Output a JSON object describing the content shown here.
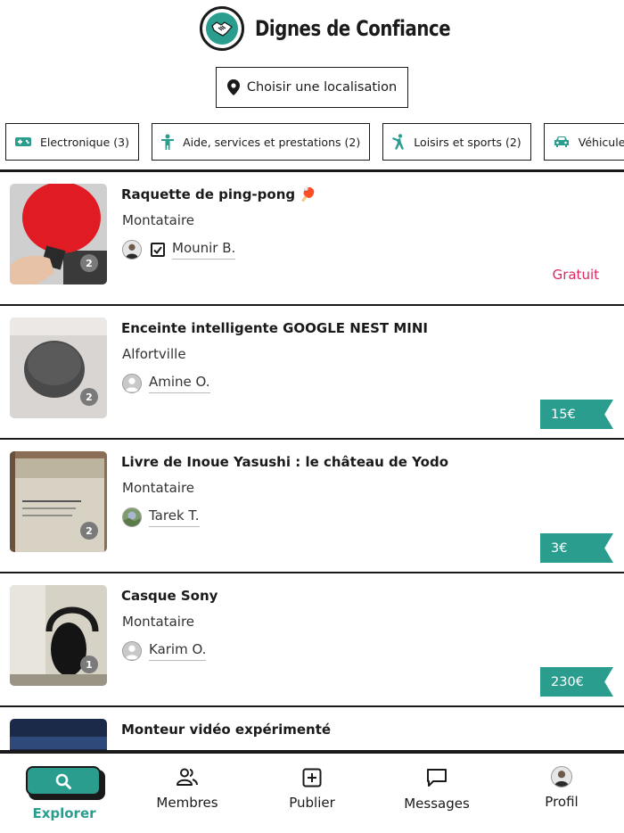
{
  "header": {
    "brand": "Dignes de Confiance",
    "location_button": "Choisir une localisation"
  },
  "categories": [
    {
      "label": "Electronique (3)",
      "icon": "gamepad-icon"
    },
    {
      "label": "Aide, services et prestations (2)",
      "icon": "person-icon"
    },
    {
      "label": "Loisirs et sports (2)",
      "icon": "sport-icon"
    },
    {
      "label": "Véhicules",
      "icon": "car-icon"
    }
  ],
  "listings": [
    {
      "title": "Raquette de ping-pong 🏓",
      "city": "Montataire",
      "seller": "Mounir B.",
      "photos": "2",
      "price": "Gratuit",
      "price_type": "free",
      "verified": true
    },
    {
      "title": "Enceinte intelligente GOOGLE NEST MINI",
      "city": "Alfortville",
      "seller": "Amine O.",
      "photos": "2",
      "price": "15€",
      "price_type": "paid"
    },
    {
      "title": "Livre de Inoue Yasushi : le château de Yodo",
      "city": "Montataire",
      "seller": "Tarek T.",
      "photos": "2",
      "price": "3€",
      "price_type": "paid"
    },
    {
      "title": "Casque Sony",
      "city": "Montataire",
      "seller": "Karim O.",
      "photos": "1",
      "price": "230€",
      "price_type": "paid"
    },
    {
      "title": "Monteur vidéo expérimenté"
    }
  ],
  "nav": {
    "explorer": "Explorer",
    "membres": "Membres",
    "publier": "Publier",
    "messages": "Messages",
    "profil": "Profil"
  },
  "colors": {
    "accent": "#2a9d8f",
    "free": "#e0245e",
    "ink": "#1a1a1a"
  }
}
